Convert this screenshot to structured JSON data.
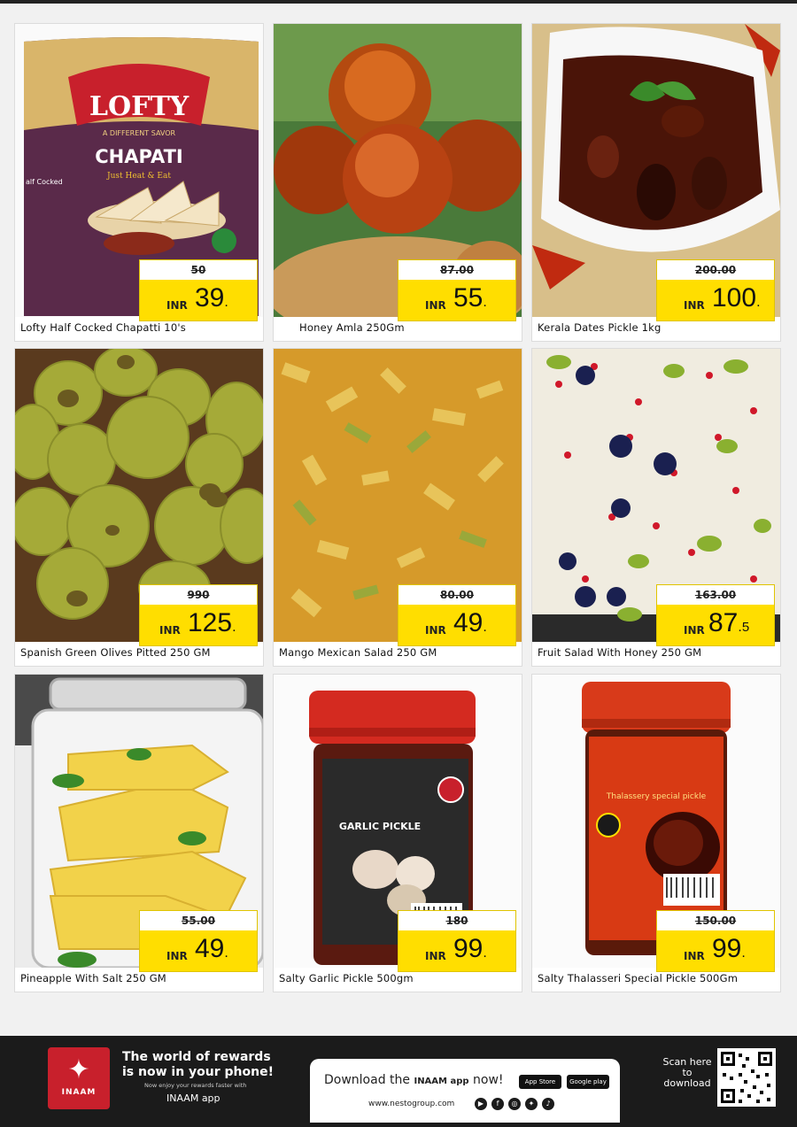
{
  "products": [
    {
      "name": "Lofty Half Cocked Chapatti 10's",
      "old_price": "50",
      "currency": "INR",
      "price": "39",
      "decimal": ""
    },
    {
      "name": "Honey Amla 250Gm",
      "old_price": "87.00",
      "currency": "INR",
      "price": "55",
      "decimal": ""
    },
    {
      "name": "Kerala Dates Pickle 1kg",
      "old_price": "200.00",
      "currency": "INR",
      "price": "100",
      "decimal": ""
    },
    {
      "name": "Spanish Green Olives Pitted 250 GM",
      "old_price": "990",
      "currency": "INR",
      "price": "125",
      "decimal": ""
    },
    {
      "name": "Mango Mexican Salad 250 GM",
      "old_price": "80.00",
      "currency": "INR",
      "price": "49",
      "decimal": ""
    },
    {
      "name": "Fruit Salad With Honey 250 GM",
      "old_price": "163.00",
      "currency": "INR",
      "price": "87",
      "decimal": "5"
    },
    {
      "name": "Pineapple With Salt 250 GM",
      "old_price": "55.00",
      "currency": "INR",
      "price": "49",
      "decimal": ""
    },
    {
      "name": "Salty Garlic Pickle 500gm",
      "old_price": "180",
      "currency": "INR",
      "price": "99",
      "decimal": ""
    },
    {
      "name": "Salty Thalasseri Special Pickle 500Gm",
      "old_price": "150.00",
      "currency": "INR",
      "price": "99",
      "decimal": ""
    }
  ],
  "packaging": {
    "lofty_brand": "LOFTY",
    "lofty_tagline": "A DIFFERENT SAVOR",
    "lofty_product": "CHAPATI",
    "lofty_sub": "Just Heat & Eat",
    "lofty_cooked": "alf Cocked",
    "garlic_label": "GARLIC PICKLE",
    "thalasseri_label": "Thalassery special pickle"
  },
  "footer": {
    "logo_text": "INAAM",
    "tagline_line1": "The world of rewards",
    "tagline_line2": "is now in your phone!",
    "tagline_sub": "Now enjoy your rewards faster with",
    "app_name": "INAAM app",
    "download_prefix": "Download the",
    "download_app": "INAAM app",
    "download_suffix": "now!",
    "app_store": "App Store",
    "google_play": "Google play",
    "website": "www.nestogroup.com",
    "scan_line1": "Scan here",
    "scan_line2": "to",
    "scan_line3": "download"
  }
}
